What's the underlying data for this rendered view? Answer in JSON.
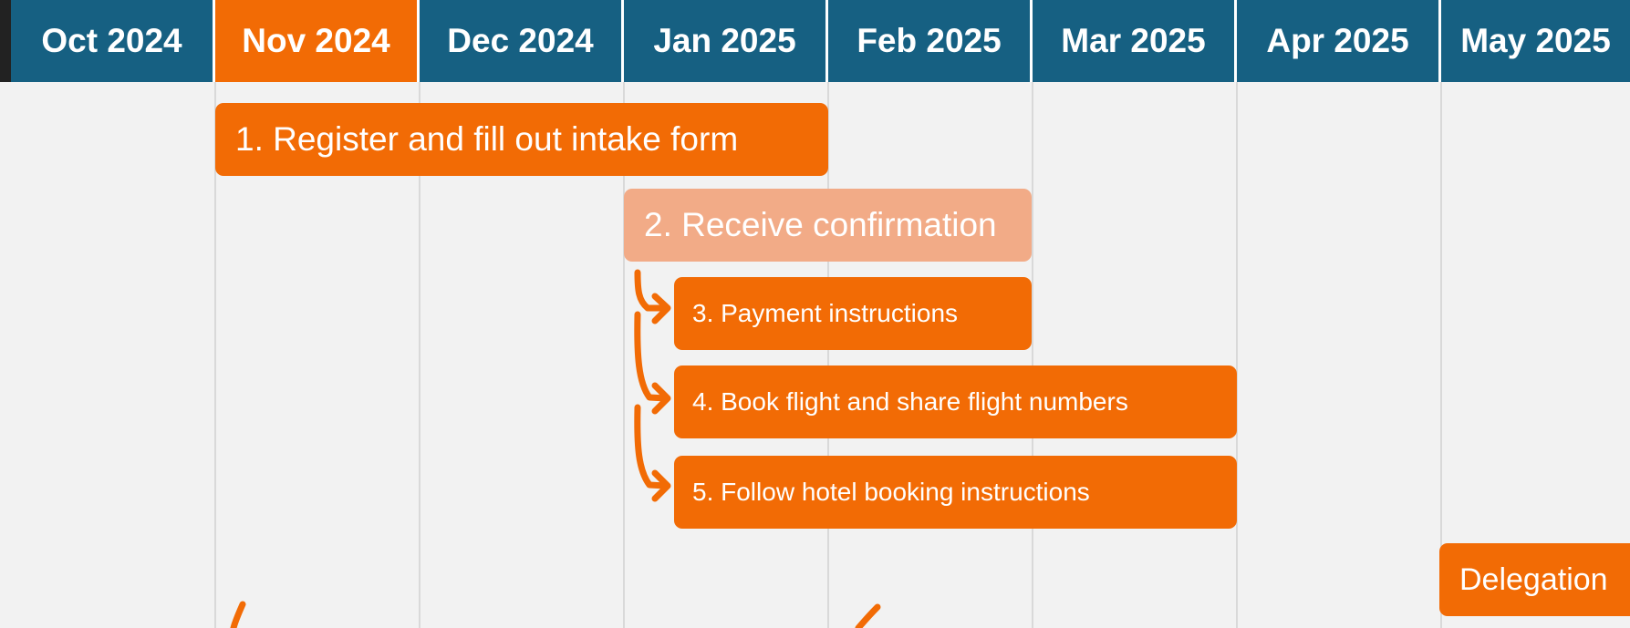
{
  "colors": {
    "header": "#166082",
    "current_month": "#f26b05",
    "task": "#f26b05",
    "task_light": "#f2ab87",
    "background": "#f2f2f2",
    "gridline": "#d9d9d9"
  },
  "timeline": {
    "months": [
      "Oct 2024",
      "Nov 2024",
      "Dec 2024",
      "Jan 2025",
      "Feb 2025",
      "Mar 2025",
      "Apr 2025",
      "May 2025"
    ],
    "current_month_index": 1
  },
  "tasks": [
    {
      "label": "1. Register and fill out intake form",
      "tone": "task"
    },
    {
      "label": "2. Receive confirmation",
      "tone": "task_light"
    },
    {
      "label": "3. Payment instructions",
      "tone": "task"
    },
    {
      "label": "4. Book flight and share flight numbers",
      "tone": "task"
    },
    {
      "label": "5. Follow hotel booking instructions",
      "tone": "task"
    },
    {
      "label": "Delegation",
      "tone": "task"
    }
  ],
  "connector_icons": [
    "branch-arrow-icon"
  ]
}
